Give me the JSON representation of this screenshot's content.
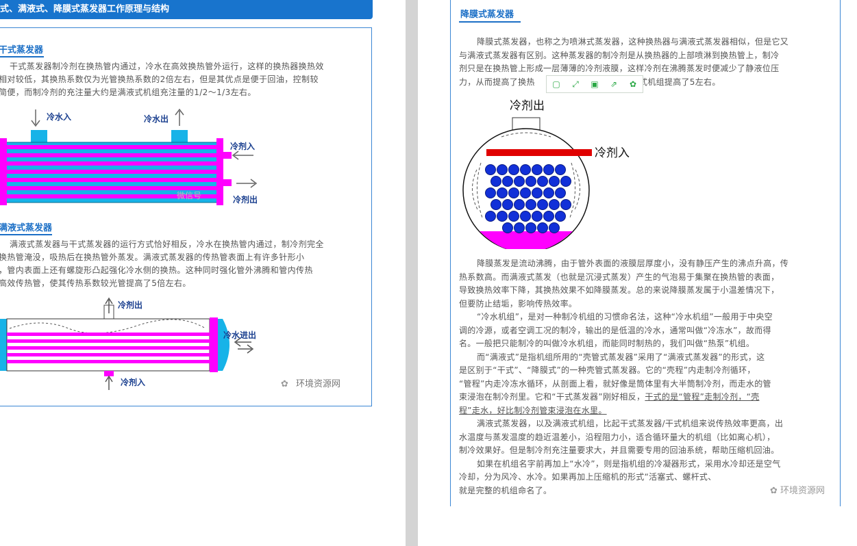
{
  "left": {
    "banner": "式、满液式、降膜式蒸发器工作原理与结构",
    "dry": {
      "title": "干式蒸发器",
      "lines": [
        "干式蒸发器制冷剂在换热管内通过，冷水在高效换热管外运行，这样的换热器换热效",
        "相对较低，其换热系数仅为光管换热系数的2倍左右，但是其优点是便于回油，控制较",
        "简便，而制冷剂的充注量大约是满液式机组充注量的1/2～1/3左右。"
      ],
      "labels": {
        "water_in": "冷水入",
        "water_out": "冷水出",
        "ref_in": "冷剂入",
        "ref_out": "冷剂出",
        "watermark": "微信号"
      }
    },
    "flooded": {
      "title": "满液式蒸发器",
      "lines": [
        "满液式蒸发器与干式蒸发器的运行方式恰好相反，冷水在换热管内通过，制冷剂完全",
        "换热管淹没，吸热后在换热管外蒸发。满液式蒸发器的传热管表面上有许多针形小",
        "，管内表面上还有螺旋形凸起强化冷水侧的换热。这种同时强化管外沸腾和管内传热",
        "高效传热管，使其传热系数较光管提高了5倍左右。"
      ],
      "labels": {
        "ref_out": "冷剂出",
        "water_io": "冷水进出",
        "ref_in": "冷剂入",
        "watermark": "环境资源网"
      }
    }
  },
  "right": {
    "falling": {
      "title": "降膜式蒸发器",
      "intro": [
        "降膜式蒸发器，也称之为喷淋式蒸发器，这种换热器与满液式蒸发器相似，但是它又",
        "与满液式蒸发器有区别。这种蒸发器的制冷剂是从换热器的上部喷淋到换热管上，制冷",
        "剂只是在换热管上形成一层薄薄的冷剂液膜，这样冷剂在沸腾蒸发时便减少了静液位压",
        "力，从而提高了换热",
        "液式机组提高了5左右。"
      ],
      "figure": {
        "ref_out": "冷剂出",
        "ref_in": "冷剂入"
      },
      "body": [
        "降膜蒸发是流动沸腾，由于管外表面的液膜层厚度小，没有静压产生的沸点升高，传",
        "热系数高。而满液式蒸发（也就是沉浸式蒸发）产生的气泡易于集聚在换热管的表面，",
        "导致换热效率下降，其换热效果不如降膜蒸发。总的来说降膜蒸发属于小温差情况下，",
        "但要防止结垢，影响传热效率。",
        "“冷水机组”，是对一种制冷机组的习惯命名法，这种“冷水机组”一般用于中央空",
        "调的冷源，或者空调工况的制冷，输出的是低温的冷水，通常叫做“冷冻水”，故而得",
        "名。一般把只能制冷的叫做冷水机组，而能同时制热的，我们叫做“热泵”机组。",
        "而“满液式”是指机组所用的“壳管式蒸发器”采用了“满液式蒸发器”的形式，这",
        "是区别于“干式”、“降膜式”的一种壳管式蒸发器。它的“壳程”内走制冷剂循环，",
        "“管程”内走冷冻水循环，从剖面上看，就好像是筒体里有大半筒制冷剂，而走水的管",
        "束浸泡在制冷剂里。它和“干式蒸发器”刚好相反，",
        "干式的是“管程”走制冷剂，“壳",
        "程”走水，好比制冷剂管束浸泡在水里。",
        "满液式蒸发器，以及满液式机组，比起干式蒸发器/干式机组来说传热效率更高，出",
        "水温度与蒸发温度的趋近温差小，沿程阻力小，适合循环量大的机组（比如离心机），",
        "制冷效果好。但是制冷剂充注量要求大，并且需要专用的回油系统，帮助压缩机回油。",
        "如果在机组名字前再加上“水冷”，则是指机组的冷凝器形式，采用水冷却还是空气",
        "冷却，分为风冷、水冷。如果再加上压缩机的形式“活塞式、螺杆式、",
        "就是完整的机组命名了。"
      ],
      "watermark": "环境资源网"
    }
  },
  "toolbar": [
    "copy-icon",
    "expand-icon",
    "save-icon",
    "share-icon",
    "settings-icon"
  ]
}
